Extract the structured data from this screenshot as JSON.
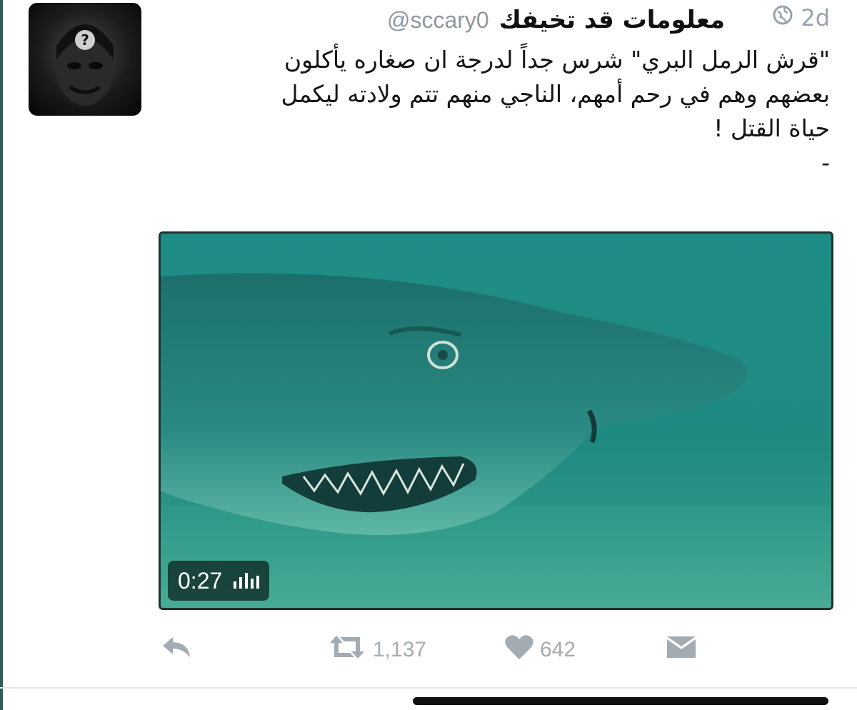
{
  "tweet": {
    "display_name": "معلومات قد تخيفك",
    "handle": "@sccary0",
    "time": "2d",
    "text_lines": [
      "\"قرش الرمل البري\" شرس جداً لدرجة ان صغاره يأكلون",
      "بعضهم وهم في رحم أمهم، الناجي منهم تتم ولادته ليكمل",
      "حياة القتل !",
      "-"
    ]
  },
  "media": {
    "type": "video",
    "duration": "0:27"
  },
  "actions": {
    "reply_icon": "reply-icon",
    "retweet_icon": "retweet-icon",
    "retweet_count": "1,137",
    "like_icon": "heart-icon",
    "like_count": "642",
    "message_icon": "envelope-icon"
  },
  "colors": {
    "accent_rule": "#2f5d56",
    "muted_text": "#9aa3ab",
    "water": "#1f8d87"
  }
}
